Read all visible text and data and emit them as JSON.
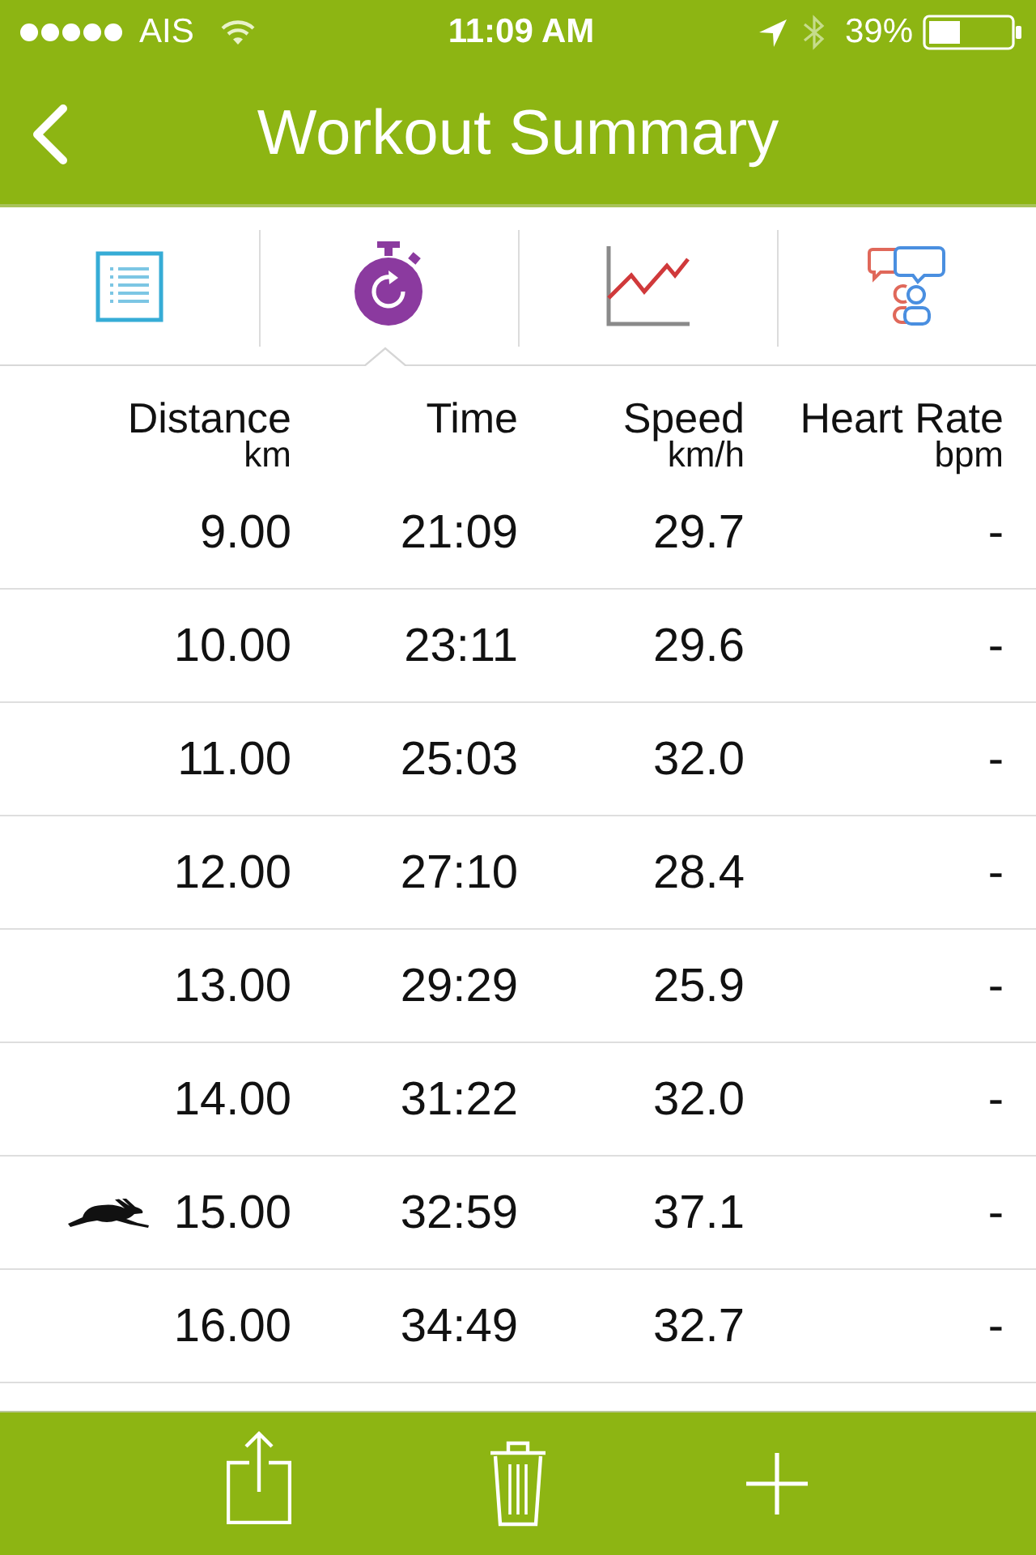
{
  "status_bar": {
    "carrier": "AIS",
    "time": "11:09 AM",
    "battery": "39%"
  },
  "nav_bar": {
    "title": "Workout Summary"
  },
  "tabs": [
    {
      "kind": "list",
      "selected": false
    },
    {
      "kind": "stopwatch",
      "selected": true
    },
    {
      "kind": "chart",
      "selected": false
    },
    {
      "kind": "people",
      "selected": false
    }
  ],
  "table": {
    "columns": [
      {
        "label": "Distance",
        "unit": "km"
      },
      {
        "label": "Time"
      },
      {
        "label": "Speed",
        "unit": "km/h"
      },
      {
        "label": "Heart Rate",
        "unit": "bpm"
      }
    ],
    "rows": [
      {
        "cells": [
          "9.00",
          "21:09",
          "29.7",
          "-"
        ],
        "fastest": false
      },
      {
        "cells": [
          "10.00",
          "23:11",
          "29.6",
          "-"
        ],
        "fastest": false
      },
      {
        "cells": [
          "11.00",
          "25:03",
          "32.0",
          "-"
        ],
        "fastest": false
      },
      {
        "cells": [
          "12.00",
          "27:10",
          "28.4",
          "-"
        ],
        "fastest": false
      },
      {
        "cells": [
          "13.00",
          "29:29",
          "25.9",
          "-"
        ],
        "fastest": false
      },
      {
        "cells": [
          "14.00",
          "31:22",
          "32.0",
          "-"
        ],
        "fastest": false
      },
      {
        "cells": [
          "15.00",
          "32:59",
          "37.1",
          "-"
        ],
        "fastest": true
      },
      {
        "cells": [
          "16.00",
          "34:49",
          "32.7",
          "-"
        ],
        "fastest": false
      }
    ]
  },
  "toolbar": {
    "buttons": [
      {
        "kind": "share"
      },
      {
        "kind": "delete"
      },
      {
        "kind": "add"
      }
    ]
  }
}
